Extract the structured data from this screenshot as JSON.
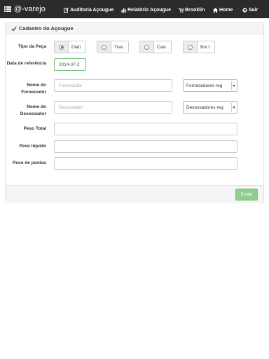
{
  "app": {
    "brand": "@-varejo"
  },
  "nav": [
    {
      "label": "Auditoria Açougue",
      "icon": "edit-icon"
    },
    {
      "label": "Relatório Açougue",
      "icon": "bar-chart-icon"
    },
    {
      "label": "Brooklin",
      "icon": "cart-icon"
    },
    {
      "label": "Home",
      "icon": "home-icon"
    },
    {
      "label": "Sair",
      "icon": "gear-icon"
    }
  ],
  "panel": {
    "title": "Cadastro do Açougue"
  },
  "form": {
    "tipo_peca": {
      "label": "Tipo da Peça",
      "options": [
        "Dian",
        "Tras",
        "Caix",
        "Boi I"
      ],
      "selected": "Dian"
    },
    "data_referencia": {
      "label": "Data de referência",
      "value": "2014-07-2"
    },
    "fornecedor": {
      "label": "Nome do Fornecedor",
      "placeholder": "Fornecedor",
      "select_value": "Fornecedores reg"
    },
    "desossador": {
      "label": "Nome do Desossador",
      "placeholder": "Desossador",
      "select_value": "Desossadores reg"
    },
    "peso_total": {
      "label": "Peso Total",
      "value": ""
    },
    "peso_liquido": {
      "label": "Peso líquido",
      "value": ""
    },
    "peso_perdas": {
      "label": "Peso de perdas",
      "value": ""
    }
  },
  "actions": {
    "submit_label": "Enviar"
  },
  "colors": {
    "navbar": "#2b2b2b",
    "submit": "#8fce8f",
    "accent": "#3a7bd5"
  }
}
